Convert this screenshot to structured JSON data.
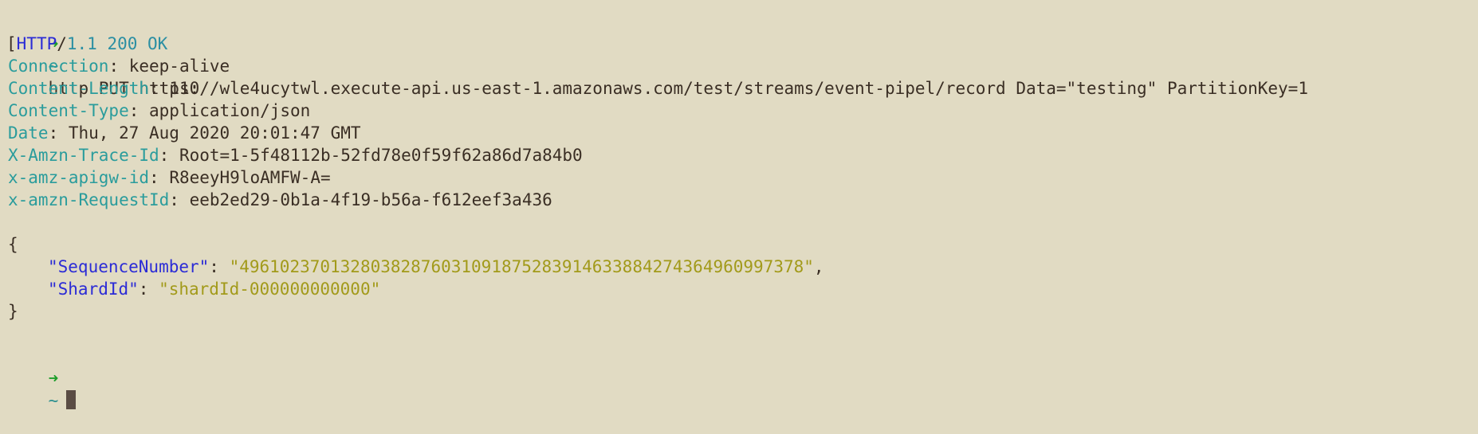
{
  "prompt": {
    "arrow": "➜",
    "dir": "~"
  },
  "command": "http PUT https://wle4ucytwl.execute-api.us-east-1.amazonaws.com/test/streams/event-pipel/record Data=\"testing\" PartitionKey=1",
  "status": {
    "bracket": "[",
    "protocol": "HTTP",
    "slash": "/",
    "version": "1.1 200 OK"
  },
  "headers": [
    {
      "key": "Connection",
      "value": "keep-alive"
    },
    {
      "key": "Content-Length",
      "value": "110"
    },
    {
      "key": "Content-Type",
      "value": "application/json"
    },
    {
      "key": "Date",
      "value": "Thu, 27 Aug 2020 20:01:47 GMT"
    },
    {
      "key": "X-Amzn-Trace-Id",
      "value": "Root=1-5f48112b-52fd78e0f59f62a86d7a84b0"
    },
    {
      "key": "x-amz-apigw-id",
      "value": "R8eeyH9loAMFW-A="
    },
    {
      "key": "x-amzn-RequestId",
      "value": "eeb2ed29-0b1a-4f19-b56a-f612eef3a436"
    }
  ],
  "body": {
    "open": "{",
    "close": "}",
    "fields": [
      {
        "key": "\"SequenceNumber\"",
        "value": "\"49610237013280382876031091875283914633884274364960997378\"",
        "trail": ","
      },
      {
        "key": "\"ShardId\"",
        "value": "\"shardId-000000000000\"",
        "trail": ""
      }
    ]
  },
  "colors": {
    "background": "#e1dbc3",
    "prompt_arrow": "#1d9e2a",
    "header_key": "#2a9c9c",
    "json_key": "#2b2bd6",
    "json_string": "#a29a1a",
    "text": "#3a2e24"
  }
}
